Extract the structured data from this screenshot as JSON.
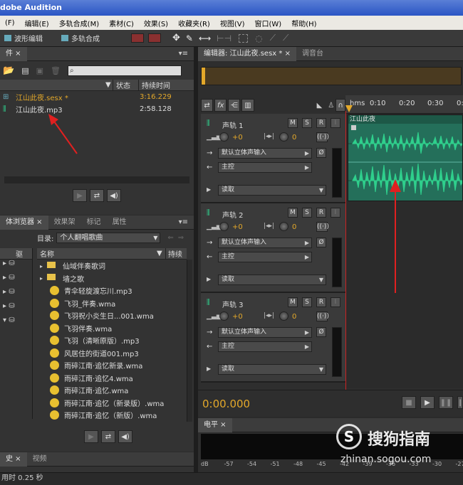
{
  "window": {
    "title": "dobe Audition"
  },
  "menu": [
    "(F)",
    "编辑(E)",
    "多轨合成(M)",
    "素材(C)",
    "效果(S)",
    "收藏夹(R)",
    "视图(V)",
    "窗口(W)",
    "帮助(H)"
  ],
  "toolbar": {
    "waveform_label": "波形编辑",
    "multitrack_label": "多轨合成"
  },
  "files_panel": {
    "tab": "件 ×",
    "columns": {
      "status": "状态",
      "duration": "持续时间"
    },
    "files": [
      {
        "name": "江山此夜.sesx *",
        "duration": "3:16.229"
      },
      {
        "name": "江山此夜.mp3",
        "duration": "2:58.128"
      }
    ]
  },
  "browser_panel": {
    "tabs": [
      "体浏览器 ×",
      "效果架",
      "标记",
      "属性"
    ],
    "dir_label": "目录:",
    "dir_value": "个人翻唱歌曲",
    "columns": {
      "name": "名称",
      "duration": "持续"
    },
    "left_column_header": "驱",
    "items": [
      {
        "name": "仙域伴奏歌词",
        "type": "folder"
      },
      {
        "name": "墙之歌",
        "type": "folder"
      },
      {
        "name": "青伞轻旋渡忘川.mp3",
        "type": "audio"
      },
      {
        "name": "飞羽_伴奏.wma",
        "type": "audio"
      },
      {
        "name": "飞羽祝小炎生日...001.wma",
        "type": "audio"
      },
      {
        "name": "飞羽伴奏.wma",
        "type": "audio"
      },
      {
        "name": "飞羽（清晰原版）.mp3",
        "type": "audio"
      },
      {
        "name": "风居住的街道001.mp3",
        "type": "audio"
      },
      {
        "name": "雨碎江南·追忆新录.wma",
        "type": "audio"
      },
      {
        "name": "雨碎江南·追忆4.wma",
        "type": "audio"
      },
      {
        "name": "雨碎江南·追忆.wma",
        "type": "audio"
      },
      {
        "name": "雨碎江南·追忆（新录版）.wma",
        "type": "audio"
      },
      {
        "name": "雨碎江南·追忆（新版）.wma",
        "type": "audio"
      }
    ]
  },
  "bottom_left_tabs": [
    "史 ×",
    "视频"
  ],
  "status_bar": {
    "text": "用时 0.25 秒"
  },
  "editor": {
    "tabs": [
      "编辑器: 江山此夜.sesx * ×",
      "调音台"
    ],
    "ruler_labels": [
      "hms",
      "0:10",
      "0:20",
      "0:30",
      "0:4"
    ],
    "clip_name": "江山此夜",
    "time_display": "0:00.000",
    "tracks": [
      {
        "name": "声轨 1",
        "volume": "+0",
        "pan": "0",
        "input": "默认立体声输入",
        "output": "主控",
        "mode": "读取"
      },
      {
        "name": "声轨 2",
        "volume": "+0",
        "pan": "0",
        "input": "默认立体声输入",
        "output": "主控",
        "mode": "读取"
      },
      {
        "name": "声轨 3",
        "volume": "+0",
        "pan": "0",
        "input": "默认立体声输入",
        "output": "主控",
        "mode": "读取"
      }
    ],
    "msr": [
      "M",
      "S",
      "R"
    ]
  },
  "levels_panel": {
    "tab": "电平 ×",
    "scale": [
      "dB",
      "-57",
      "-54",
      "-51",
      "-48",
      "-45",
      "-42",
      "-39",
      "-36",
      "-33",
      "-30",
      "-27"
    ]
  },
  "watermark": {
    "brand": "搜狗指南",
    "url": "zhinan.sogou.com"
  },
  "colors": {
    "waveform": "#2fcf8c",
    "accent": "#e3a82a",
    "playhead": "#cc2222",
    "annotation_arrow": "#e02020"
  }
}
